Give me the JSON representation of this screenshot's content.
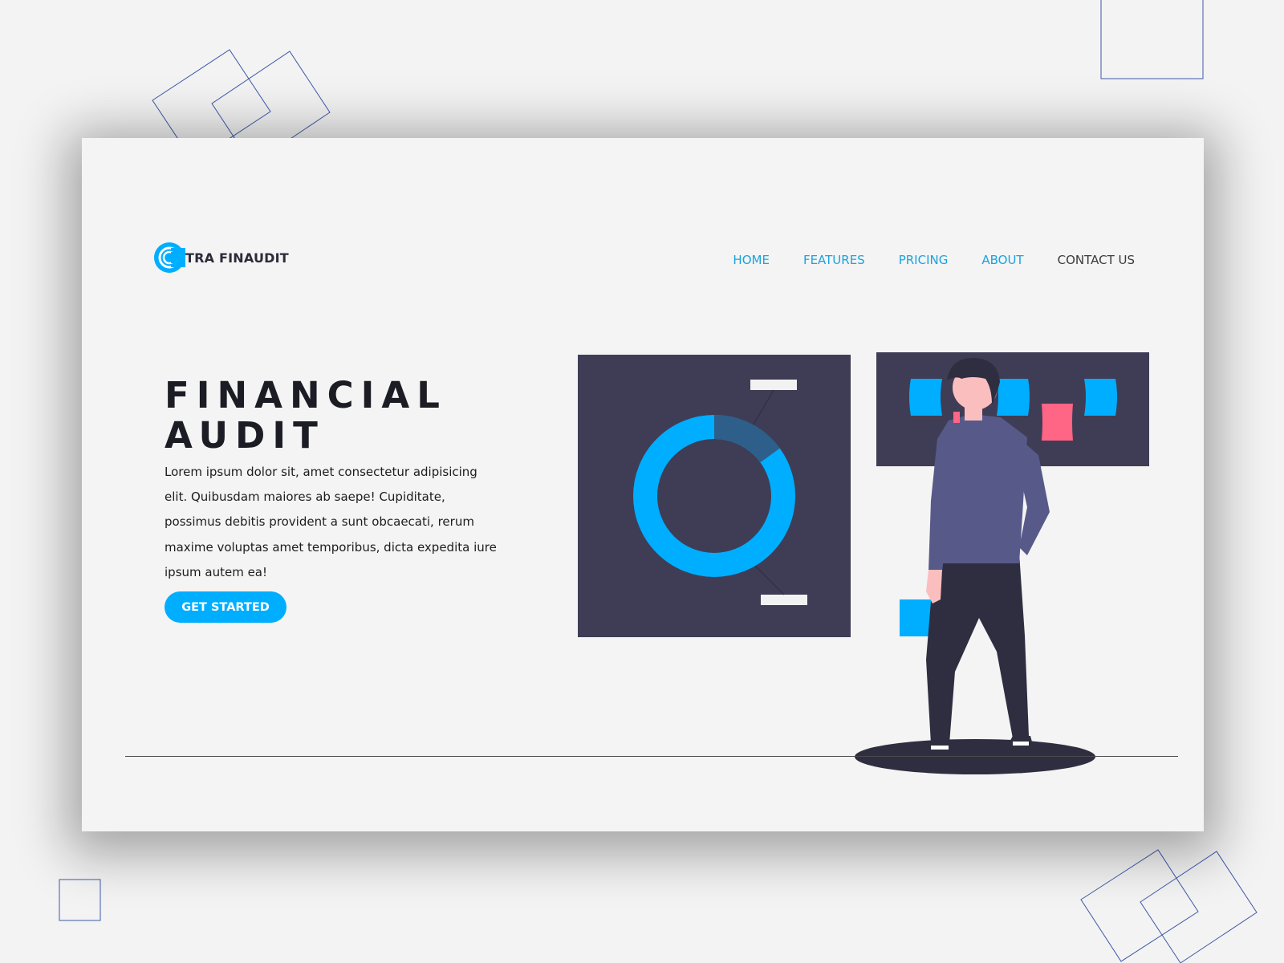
{
  "brand": {
    "name": "TRA FINAUDIT",
    "accent": "#00aeff",
    "dark": "#3f3d56"
  },
  "nav": {
    "items": [
      {
        "label": "HOME",
        "color": "#1aa3dd"
      },
      {
        "label": "FEATURES",
        "color": "#1aa3dd"
      },
      {
        "label": "PRICING",
        "color": "#1aa3dd"
      },
      {
        "label": "ABOUT",
        "color": "#1aa3dd"
      },
      {
        "label": "CONTACT US",
        "color": "#3a3a3a"
      }
    ]
  },
  "hero": {
    "title_line1": "FINANCIAL",
    "title_line2": "AUDIT",
    "body": "Lorem ipsum dolor sit, amet consectetur adipisicing elit. Quibusdam maiores ab saepe! Cupiditate, possimus debitis provident a sunt obcaecati, rerum maxime voluptas amet temporibus, dicta expedita iure ipsum autem ea!",
    "cta_label": "GET STARTED",
    "cta_color": "#00aeff"
  },
  "illustration": {
    "donut_share": 0.15,
    "colors": {
      "panel": "#3f3d56",
      "donut_main": "#00aeff",
      "donut_segment": "#2d5f8a",
      "pink": "#ff6584",
      "shirt": "#575a89",
      "pants": "#2f2e41",
      "skin": "#fbbebe",
      "hair": "#2f2e41"
    }
  }
}
